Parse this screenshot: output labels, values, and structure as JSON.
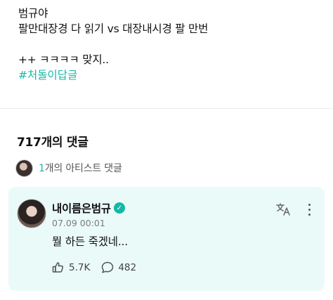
{
  "post": {
    "lines": [
      "범규야",
      "팔만대장경 다 읽기 vs 대장내시경 팔 만번",
      "++ ㅋㅋㅋㅋ 맞지.."
    ],
    "hashtag": "#처돌이답글"
  },
  "comments": {
    "count_label": "717개의 댓글",
    "artist_comments": {
      "count": "1",
      "label": "개의 아티스트 댓글"
    }
  },
  "comment": {
    "author": "내이름은범규",
    "verified_mark": "✓",
    "timestamp": "07.09 00:01",
    "body": "뭘 하든 죽겠네...",
    "likes": "5.7K",
    "replies": "482"
  },
  "icons": [
    "verified-badge-icon",
    "translate-icon",
    "more-options-icon",
    "like-icon",
    "reply-icon"
  ],
  "colors": {
    "accent": "#14b8a6",
    "card_bg": "#eafaf8"
  }
}
